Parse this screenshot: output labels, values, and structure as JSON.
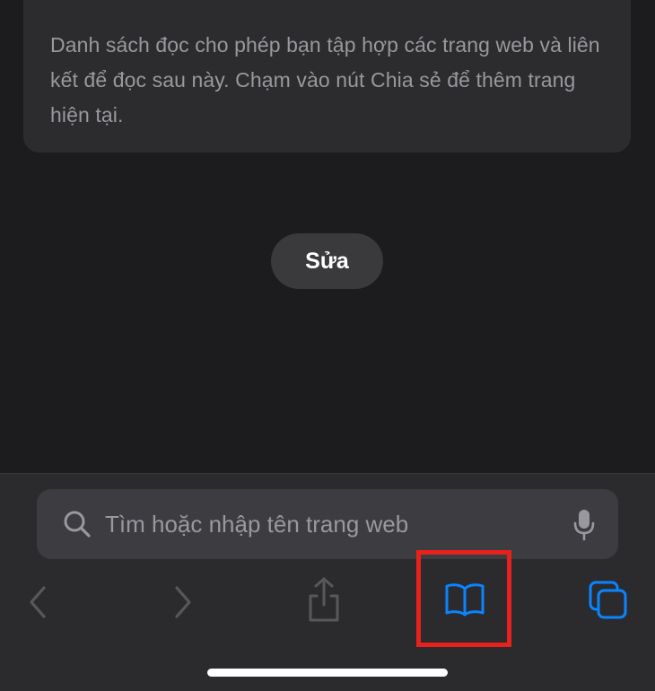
{
  "reading_list": {
    "info_text": "Danh sách đọc cho phép bạn tập hợp các trang web và liên kết để đọc sau này. Chạm vào nút Chia sẻ để thêm trang hiện tại.",
    "edit_label": "Sửa"
  },
  "search": {
    "placeholder": "Tìm hoặc nhập tên trang web",
    "search_icon": "search-icon",
    "mic_icon": "microphone-icon"
  },
  "toolbar": {
    "items": [
      {
        "icon": "chevron-left-icon",
        "enabled": false
      },
      {
        "icon": "chevron-right-icon",
        "enabled": false
      },
      {
        "icon": "share-icon",
        "enabled": false
      },
      {
        "icon": "book-icon",
        "enabled": true,
        "highlighted": true
      },
      {
        "icon": "tabs-icon",
        "enabled": true
      }
    ]
  },
  "colors": {
    "background": "#1c1c1e",
    "card": "#2c2c2e",
    "accent": "#0a84ff",
    "highlight": "#e8211c",
    "disabled_icon": "#58585c"
  }
}
